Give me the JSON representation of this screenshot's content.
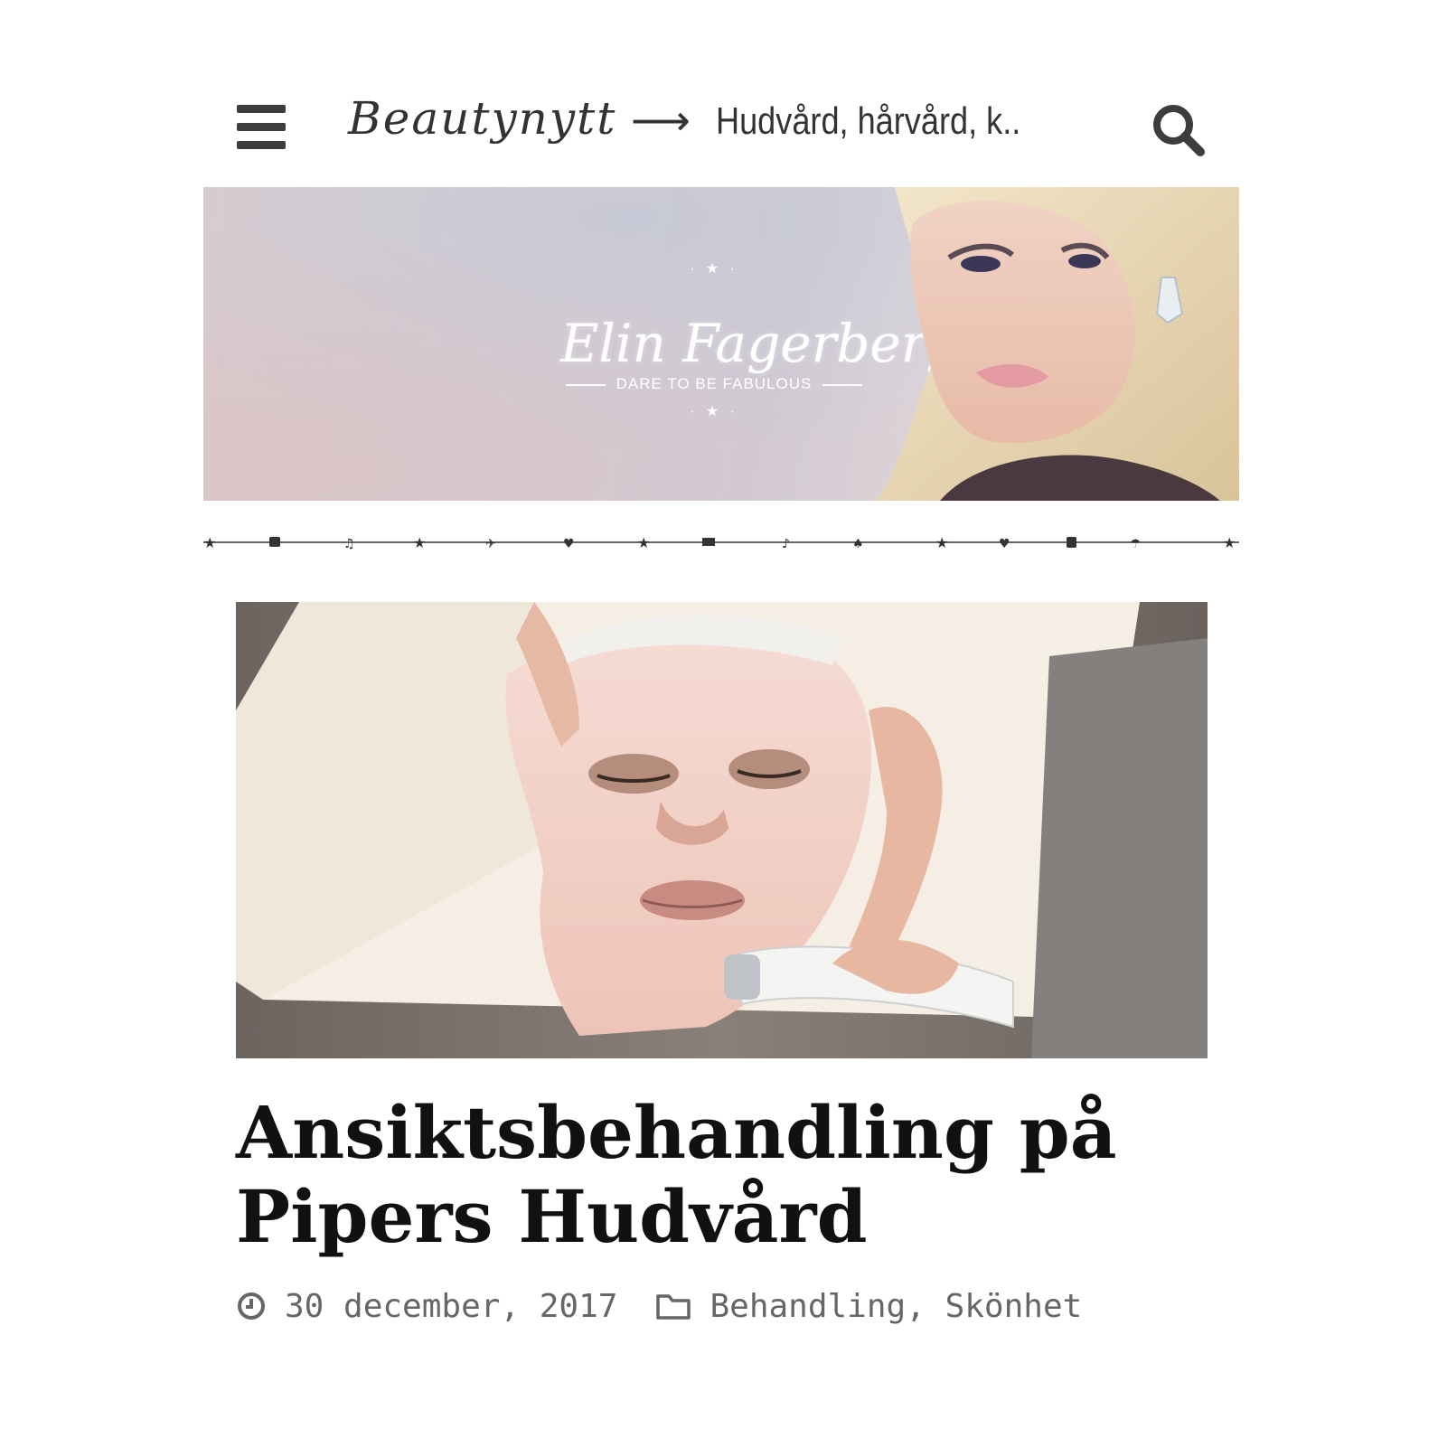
{
  "nav": {
    "menu_icon": "hamburger-icon",
    "site_name": "Beautynytt",
    "arrow": "⟶",
    "section": "Hudvård, hårvård, k..",
    "search_icon": "search-icon",
    "text_color": "#333333"
  },
  "banner": {
    "name": "Elin Fagerberg",
    "tagline": "DARE TO BE FABULOUS",
    "stars": "· ★ ·"
  },
  "article": {
    "title": "Ansiktsbehandling på Pipers Hudvård",
    "date": "30 december, 2017",
    "date_icon": "clock-icon",
    "category_icon": "folder-icon",
    "categories": [
      "Behandling",
      "Skönhet"
    ],
    "category_separator": ", "
  }
}
